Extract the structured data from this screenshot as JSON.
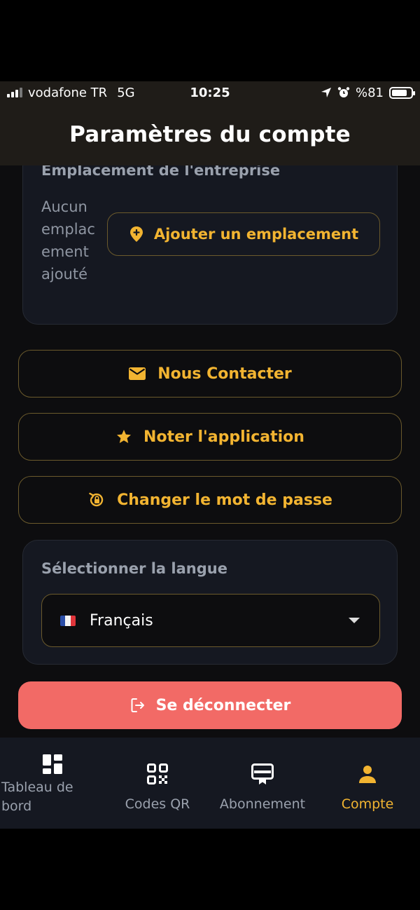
{
  "status": {
    "carrier": "vodafone TR",
    "network": "5G",
    "time": "10:25",
    "battery": "%81",
    "battery_level": 0.81
  },
  "header": {
    "title": "Paramètres du compte"
  },
  "location": {
    "title": "Emplacement de l'entreprise",
    "empty_text": "Aucun emplacement ajouté",
    "add_button": "Ajouter un emplacement"
  },
  "actions": {
    "contact": "Nous Contacter",
    "rate": "Noter l'application",
    "change_password": "Changer le mot de passe"
  },
  "language": {
    "title": "Sélectionner la langue",
    "selected": "Français"
  },
  "logout": {
    "label": "Se déconnecter"
  },
  "tabs": [
    {
      "label": "Tableau de bord",
      "icon": "dashboard-icon"
    },
    {
      "label": "Codes QR",
      "icon": "qr-code-icon"
    },
    {
      "label": "Abonnement",
      "icon": "subscription-icon"
    },
    {
      "label": "Compte",
      "icon": "person-icon"
    }
  ],
  "colors": {
    "accent": "#f2b431",
    "logout": "#f26a66",
    "card": "#151821",
    "background": "#0d0d0f"
  }
}
